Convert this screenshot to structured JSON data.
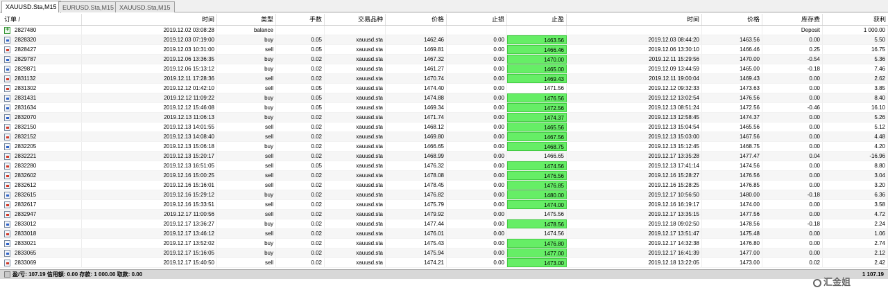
{
  "tabs": [
    {
      "label": "XAUUSD.Sta,M15",
      "active": true
    },
    {
      "label": "EURUSD.Sta,M15",
      "active": false
    },
    {
      "label": "XAUUSD.Sta,M15",
      "active": false
    }
  ],
  "columns": {
    "ticket": "订单 /",
    "open_time": "时间",
    "type": "类型",
    "volume": "手数",
    "symbol": "交易品种",
    "open_price": "价格",
    "sl": "止损",
    "tp": "止盈",
    "close_time": "时间",
    "close_price": "价格",
    "swap": "库存费",
    "profit": "获利"
  },
  "rows": [
    {
      "icon": "balance",
      "ticket": "2827480",
      "open_time": "2019.12.02 03:08:28",
      "type": "balance",
      "volume": "",
      "symbol": "",
      "open_price": "",
      "sl": "",
      "tp": "",
      "tp_hit": false,
      "close_time": "",
      "close_price": "",
      "swap": "Deposit",
      "profit": "1 000.00"
    },
    {
      "icon": "buy",
      "ticket": "2828320",
      "open_time": "2019.12.03 07:19:00",
      "type": "buy",
      "volume": "0.05",
      "symbol": "xauusd.sta",
      "open_price": "1462.46",
      "sl": "0.00",
      "tp": "1463.56",
      "tp_hit": true,
      "close_time": "2019.12.03 08:44:20",
      "close_price": "1463.56",
      "swap": "0.00",
      "profit": "5.50"
    },
    {
      "icon": "sell",
      "ticket": "2828427",
      "open_time": "2019.12.03 10:31:00",
      "type": "sell",
      "volume": "0.05",
      "symbol": "xauusd.sta",
      "open_price": "1469.81",
      "sl": "0.00",
      "tp": "1466.46",
      "tp_hit": true,
      "close_time": "2019.12.06 13:30:10",
      "close_price": "1466.46",
      "swap": "0.25",
      "profit": "16.75"
    },
    {
      "icon": "buy",
      "ticket": "2829787",
      "open_time": "2019.12.06 13:36:35",
      "type": "buy",
      "volume": "0.02",
      "symbol": "xauusd.sta",
      "open_price": "1467.32",
      "sl": "0.00",
      "tp": "1470.00",
      "tp_hit": true,
      "close_time": "2019.12.11 15:29:56",
      "close_price": "1470.00",
      "swap": "-0.54",
      "profit": "5.36"
    },
    {
      "icon": "buy",
      "ticket": "2829871",
      "open_time": "2019.12.06 15:13:12",
      "type": "buy",
      "volume": "0.02",
      "symbol": "xauusd.sta",
      "open_price": "1461.27",
      "sl": "0.00",
      "tp": "1465.00",
      "tp_hit": true,
      "close_time": "2019.12.09 13:44:59",
      "close_price": "1465.00",
      "swap": "-0.18",
      "profit": "7.46"
    },
    {
      "icon": "sell",
      "ticket": "2831132",
      "open_time": "2019.12.11 17:28:36",
      "type": "sell",
      "volume": "0.02",
      "symbol": "xauusd.sta",
      "open_price": "1470.74",
      "sl": "0.00",
      "tp": "1469.43",
      "tp_hit": true,
      "close_time": "2019.12.11 19:00:04",
      "close_price": "1469.43",
      "swap": "0.00",
      "profit": "2.62"
    },
    {
      "icon": "sell",
      "ticket": "2831302",
      "open_time": "2019.12.12 01:42:10",
      "type": "sell",
      "volume": "0.05",
      "symbol": "xauusd.sta",
      "open_price": "1474.40",
      "sl": "0.00",
      "tp": "1471.56",
      "tp_hit": false,
      "close_time": "2019.12.12 09:32:33",
      "close_price": "1473.63",
      "swap": "0.00",
      "profit": "3.85"
    },
    {
      "icon": "buy",
      "ticket": "2831431",
      "open_time": "2019.12.12 11:09:22",
      "type": "buy",
      "volume": "0.05",
      "symbol": "xauusd.sta",
      "open_price": "1474.88",
      "sl": "0.00",
      "tp": "1476.56",
      "tp_hit": true,
      "close_time": "2019.12.12 13:02:54",
      "close_price": "1476.56",
      "swap": "0.00",
      "profit": "8.40"
    },
    {
      "icon": "buy",
      "ticket": "2831634",
      "open_time": "2019.12.12 15:46:08",
      "type": "buy",
      "volume": "0.05",
      "symbol": "xauusd.sta",
      "open_price": "1469.34",
      "sl": "0.00",
      "tp": "1472.56",
      "tp_hit": true,
      "close_time": "2019.12.13 08:51:24",
      "close_price": "1472.56",
      "swap": "-0.46",
      "profit": "16.10"
    },
    {
      "icon": "buy",
      "ticket": "2832070",
      "open_time": "2019.12.13 11:06:13",
      "type": "buy",
      "volume": "0.02",
      "symbol": "xauusd.sta",
      "open_price": "1471.74",
      "sl": "0.00",
      "tp": "1474.37",
      "tp_hit": true,
      "close_time": "2019.12.13 12:58:45",
      "close_price": "1474.37",
      "swap": "0.00",
      "profit": "5.26"
    },
    {
      "icon": "sell",
      "ticket": "2832150",
      "open_time": "2019.12.13 14:01:55",
      "type": "sell",
      "volume": "0.02",
      "symbol": "xauusd.sta",
      "open_price": "1468.12",
      "sl": "0.00",
      "tp": "1465.56",
      "tp_hit": true,
      "close_time": "2019.12.13 15:04:54",
      "close_price": "1465.56",
      "swap": "0.00",
      "profit": "5.12"
    },
    {
      "icon": "sell",
      "ticket": "2832152",
      "open_time": "2019.12.13 14:08:40",
      "type": "sell",
      "volume": "0.02",
      "symbol": "xauusd.sta",
      "open_price": "1469.80",
      "sl": "0.00",
      "tp": "1467.56",
      "tp_hit": true,
      "close_time": "2019.12.13 15:03:00",
      "close_price": "1467.56",
      "swap": "0.00",
      "profit": "4.48"
    },
    {
      "icon": "buy",
      "ticket": "2832205",
      "open_time": "2019.12.13 15:06:18",
      "type": "buy",
      "volume": "0.02",
      "symbol": "xauusd.sta",
      "open_price": "1466.65",
      "sl": "0.00",
      "tp": "1468.75",
      "tp_hit": true,
      "close_time": "2019.12.13 15:12:45",
      "close_price": "1468.75",
      "swap": "0.00",
      "profit": "4.20"
    },
    {
      "icon": "sell",
      "ticket": "2832221",
      "open_time": "2019.12.13 15:20:17",
      "type": "sell",
      "volume": "0.02",
      "symbol": "xauusd.sta",
      "open_price": "1468.99",
      "sl": "0.00",
      "tp": "1466.65",
      "tp_hit": false,
      "close_time": "2019.12.17 13:35:28",
      "close_price": "1477.47",
      "swap": "0.04",
      "profit": "-16.96"
    },
    {
      "icon": "sell",
      "ticket": "2832280",
      "open_time": "2019.12.13 16:51:05",
      "type": "sell",
      "volume": "0.05",
      "symbol": "xauusd.sta",
      "open_price": "1476.32",
      "sl": "0.00",
      "tp": "1474.56",
      "tp_hit": true,
      "close_time": "2019.12.13 17:41:14",
      "close_price": "1474.56",
      "swap": "0.00",
      "profit": "8.80"
    },
    {
      "icon": "sell",
      "ticket": "2832602",
      "open_time": "2019.12.16 15:00:25",
      "type": "sell",
      "volume": "0.02",
      "symbol": "xauusd.sta",
      "open_price": "1478.08",
      "sl": "0.00",
      "tp": "1476.56",
      "tp_hit": true,
      "close_time": "2019.12.16 15:28:27",
      "close_price": "1476.56",
      "swap": "0.00",
      "profit": "3.04"
    },
    {
      "icon": "sell",
      "ticket": "2832612",
      "open_time": "2019.12.16 15:16:01",
      "type": "sell",
      "volume": "0.02",
      "symbol": "xauusd.sta",
      "open_price": "1478.45",
      "sl": "0.00",
      "tp": "1476.85",
      "tp_hit": true,
      "close_time": "2019.12.16 15:28:25",
      "close_price": "1476.85",
      "swap": "0.00",
      "profit": "3.20"
    },
    {
      "icon": "buy",
      "ticket": "2832615",
      "open_time": "2019.12.16 15:29:12",
      "type": "buy",
      "volume": "0.02",
      "symbol": "xauusd.sta",
      "open_price": "1476.82",
      "sl": "0.00",
      "tp": "1480.00",
      "tp_hit": true,
      "close_time": "2019.12.17 10:56:50",
      "close_price": "1480.00",
      "swap": "-0.18",
      "profit": "6.36"
    },
    {
      "icon": "sell",
      "ticket": "2832617",
      "open_time": "2019.12.16 15:33:51",
      "type": "sell",
      "volume": "0.02",
      "symbol": "xauusd.sta",
      "open_price": "1475.79",
      "sl": "0.00",
      "tp": "1474.00",
      "tp_hit": true,
      "close_time": "2019.12.16 16:19:17",
      "close_price": "1474.00",
      "swap": "0.00",
      "profit": "3.58"
    },
    {
      "icon": "sell",
      "ticket": "2832947",
      "open_time": "2019.12.17 11:00:56",
      "type": "sell",
      "volume": "0.02",
      "symbol": "xauusd.sta",
      "open_price": "1479.92",
      "sl": "0.00",
      "tp": "1475.56",
      "tp_hit": false,
      "close_time": "2019.12.17 13:35:15",
      "close_price": "1477.56",
      "swap": "0.00",
      "profit": "4.72"
    },
    {
      "icon": "buy",
      "ticket": "2833012",
      "open_time": "2019.12.17 13:36:27",
      "type": "buy",
      "volume": "0.02",
      "symbol": "xauusd.sta",
      "open_price": "1477.44",
      "sl": "0.00",
      "tp": "1478.56",
      "tp_hit": true,
      "close_time": "2019.12.18 09:02:50",
      "close_price": "1478.56",
      "swap": "-0.18",
      "profit": "2.24"
    },
    {
      "icon": "sell",
      "ticket": "2833018",
      "open_time": "2019.12.17 13:46:12",
      "type": "sell",
      "volume": "0.02",
      "symbol": "xauusd.sta",
      "open_price": "1476.01",
      "sl": "0.00",
      "tp": "1474.56",
      "tp_hit": false,
      "close_time": "2019.12.17 13:51:47",
      "close_price": "1475.48",
      "swap": "0.00",
      "profit": "1.06"
    },
    {
      "icon": "buy",
      "ticket": "2833021",
      "open_time": "2019.12.17 13:52:02",
      "type": "buy",
      "volume": "0.02",
      "symbol": "xauusd.sta",
      "open_price": "1475.43",
      "sl": "0.00",
      "tp": "1476.80",
      "tp_hit": true,
      "close_time": "2019.12.17 14:32:38",
      "close_price": "1476.80",
      "swap": "0.00",
      "profit": "2.74"
    },
    {
      "icon": "buy",
      "ticket": "2833065",
      "open_time": "2019.12.17 15:16:05",
      "type": "buy",
      "volume": "0.02",
      "symbol": "xauusd.sta",
      "open_price": "1475.94",
      "sl": "0.00",
      "tp": "1477.00",
      "tp_hit": true,
      "close_time": "2019.12.17 16:41:39",
      "close_price": "1477.00",
      "swap": "0.00",
      "profit": "2.12"
    },
    {
      "icon": "sell",
      "ticket": "2833069",
      "open_time": "2019.12.17 15:40:50",
      "type": "sell",
      "volume": "0.02",
      "symbol": "xauusd.sta",
      "open_price": "1474.21",
      "sl": "0.00",
      "tp": "1473.00",
      "tp_hit": true,
      "close_time": "2019.12.18 13:22:05",
      "close_price": "1473.00",
      "swap": "0.02",
      "profit": "2.42"
    }
  ],
  "footer": {
    "summary": "盈/亏: 107.19  信用额: 0.00  存款: 1 000.00  取款: 0.00",
    "total_profit": "1 107.19"
  },
  "watermark": "汇金姐",
  "colors": {
    "tp_hit": "#66ee66",
    "buy_icon": "#2f63c8",
    "sell_icon": "#d03a2a"
  }
}
